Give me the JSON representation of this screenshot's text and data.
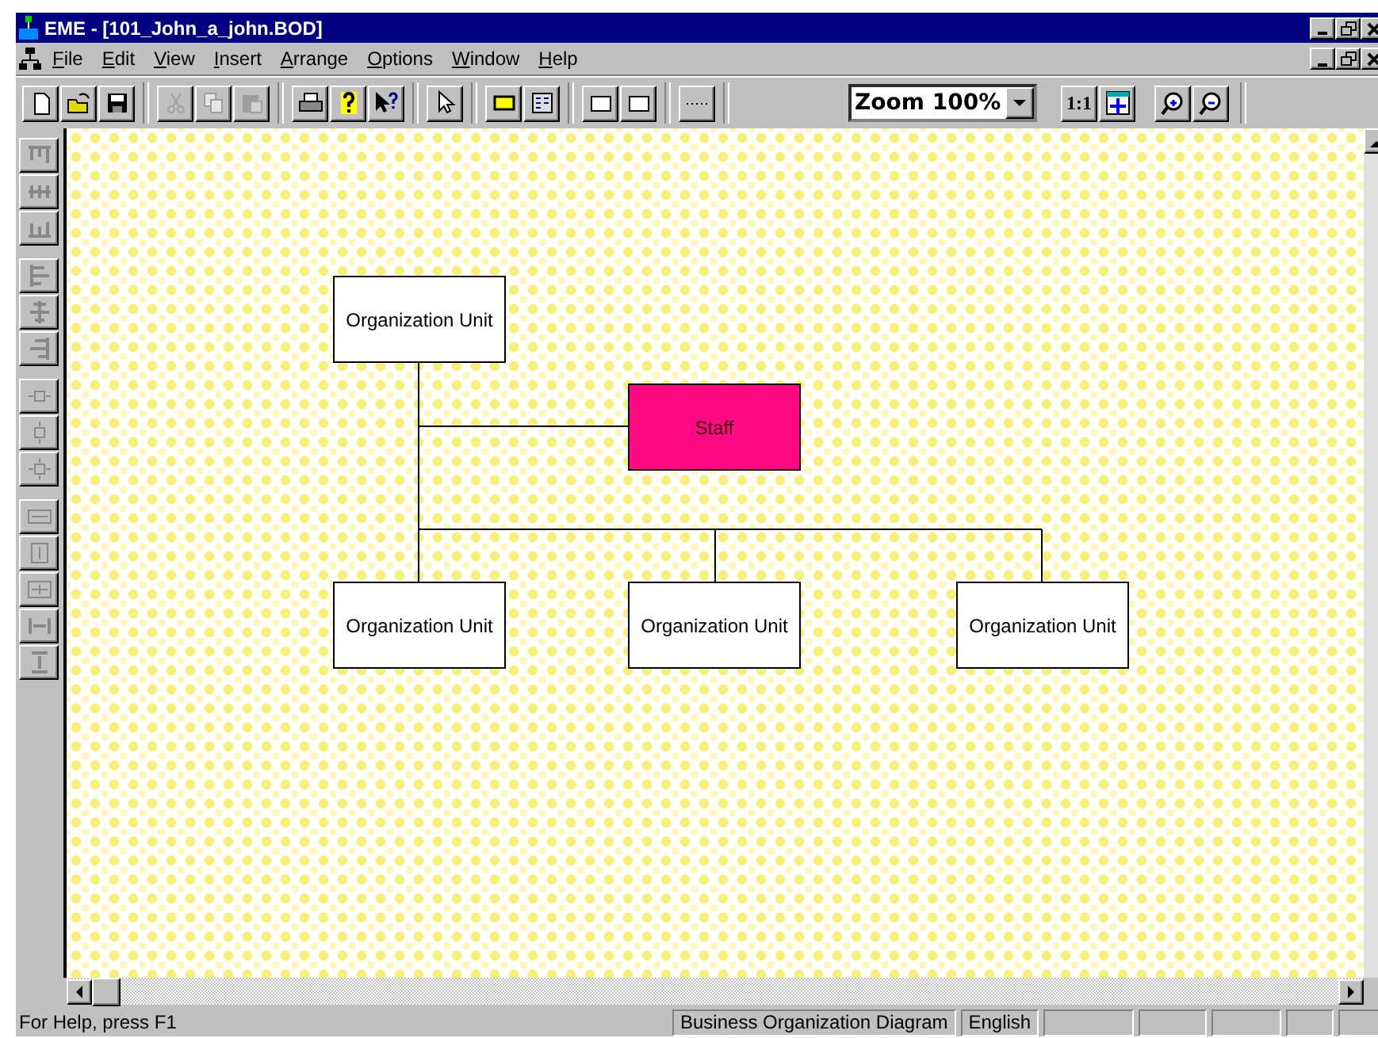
{
  "window": {
    "title": "EME - [101_John_a_john.BOD]"
  },
  "menu": [
    "File",
    "Edit",
    "View",
    "Insert",
    "Arrange",
    "Options",
    "Window",
    "Help"
  ],
  "toolbar": [
    {
      "kind": "new",
      "disabled": false
    },
    {
      "kind": "open",
      "disabled": false
    },
    {
      "kind": "save",
      "disabled": false
    },
    {
      "kind": "sep"
    },
    {
      "kind": "cut",
      "disabled": true
    },
    {
      "kind": "copy",
      "disabled": true
    },
    {
      "kind": "paste",
      "disabled": true
    },
    {
      "kind": "sep"
    },
    {
      "kind": "print",
      "disabled": false
    },
    {
      "kind": "help",
      "disabled": false
    },
    {
      "kind": "context-help",
      "disabled": false
    },
    {
      "kind": "sep"
    },
    {
      "kind": "pointer",
      "disabled": false
    },
    {
      "kind": "sep"
    },
    {
      "kind": "filled-box",
      "disabled": false
    },
    {
      "kind": "card",
      "disabled": false
    },
    {
      "kind": "sep"
    },
    {
      "kind": "box",
      "disabled": false
    },
    {
      "kind": "box",
      "disabled": false
    },
    {
      "kind": "sep"
    },
    {
      "kind": "dotted",
      "disabled": false
    },
    {
      "kind": "sep"
    }
  ],
  "zoom": {
    "value": "Zoom 100%"
  },
  "view_buttons": [
    "1:1"
  ],
  "diagram": {
    "nodes": [
      {
        "label": "Organization Unit",
        "kind": "org-unit"
      },
      {
        "label": "Staff",
        "kind": "staff"
      },
      {
        "label": "Organization Unit",
        "kind": "org-unit"
      },
      {
        "label": "Organization Unit",
        "kind": "org-unit"
      },
      {
        "label": "Organization Unit",
        "kind": "org-unit"
      }
    ]
  },
  "status_bar": {
    "hint": "For Help, press F1",
    "panes": [
      "Business Organization Diagram",
      "English"
    ]
  }
}
